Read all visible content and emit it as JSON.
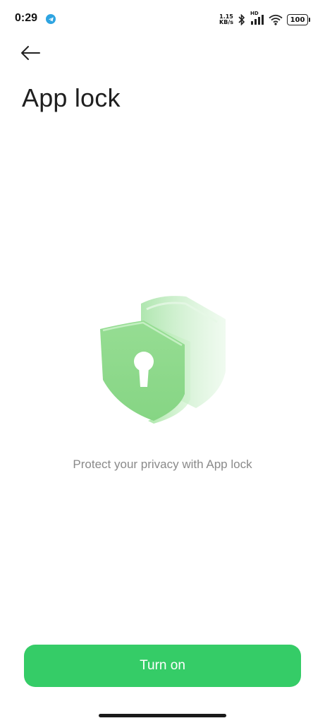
{
  "status_bar": {
    "time": "0:29",
    "net_speed_value": "1.15",
    "net_speed_unit": "KB/s",
    "network_type": "HD",
    "battery_level": "100",
    "icons": [
      "telegram-icon",
      "bluetooth-icon",
      "signal-icon",
      "wifi-icon",
      "battery-icon"
    ]
  },
  "header": {
    "back_icon": "arrow-left-icon",
    "title": "App lock"
  },
  "main": {
    "illustration": "shield-lock-icon",
    "description": "Protect your privacy with App lock"
  },
  "footer": {
    "turn_on_label": "Turn on"
  },
  "colors": {
    "accent": "#35cc67",
    "shield_green": "#8fdc8f",
    "description_text": "#8a8a8a"
  }
}
